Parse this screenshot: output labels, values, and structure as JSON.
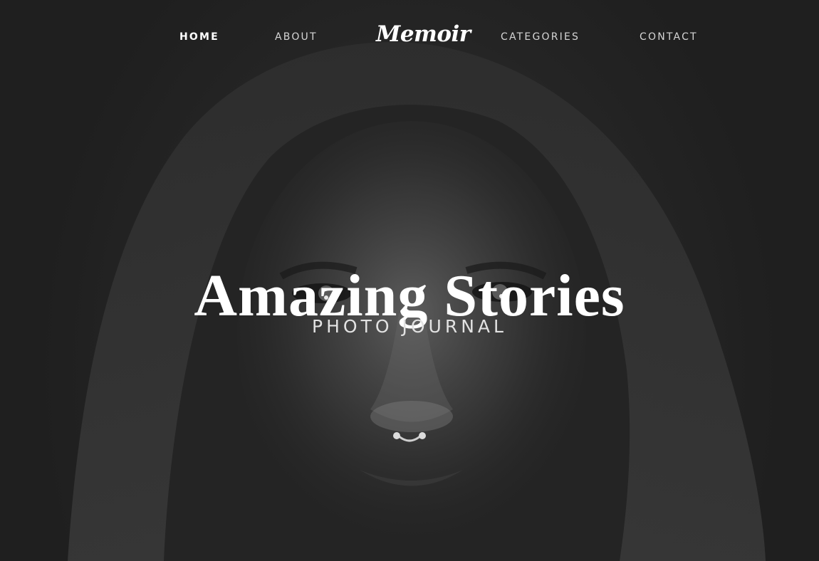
{
  "nav": {
    "items": [
      {
        "label": "HOME",
        "active": true
      },
      {
        "label": "ABOUT",
        "active": false
      },
      {
        "label": "CATEGORIES",
        "active": false
      },
      {
        "label": "CONTACT",
        "active": false
      }
    ],
    "logo": "Memoir"
  },
  "hero": {
    "title": "Amazing Stories",
    "subtitle": "PHOTO JOURNAL",
    "image_icon": "hooded-face-portrait"
  },
  "colors": {
    "background": "#1f1f1f",
    "text": "#ffffff",
    "nav_text": "#d6d6d6"
  }
}
